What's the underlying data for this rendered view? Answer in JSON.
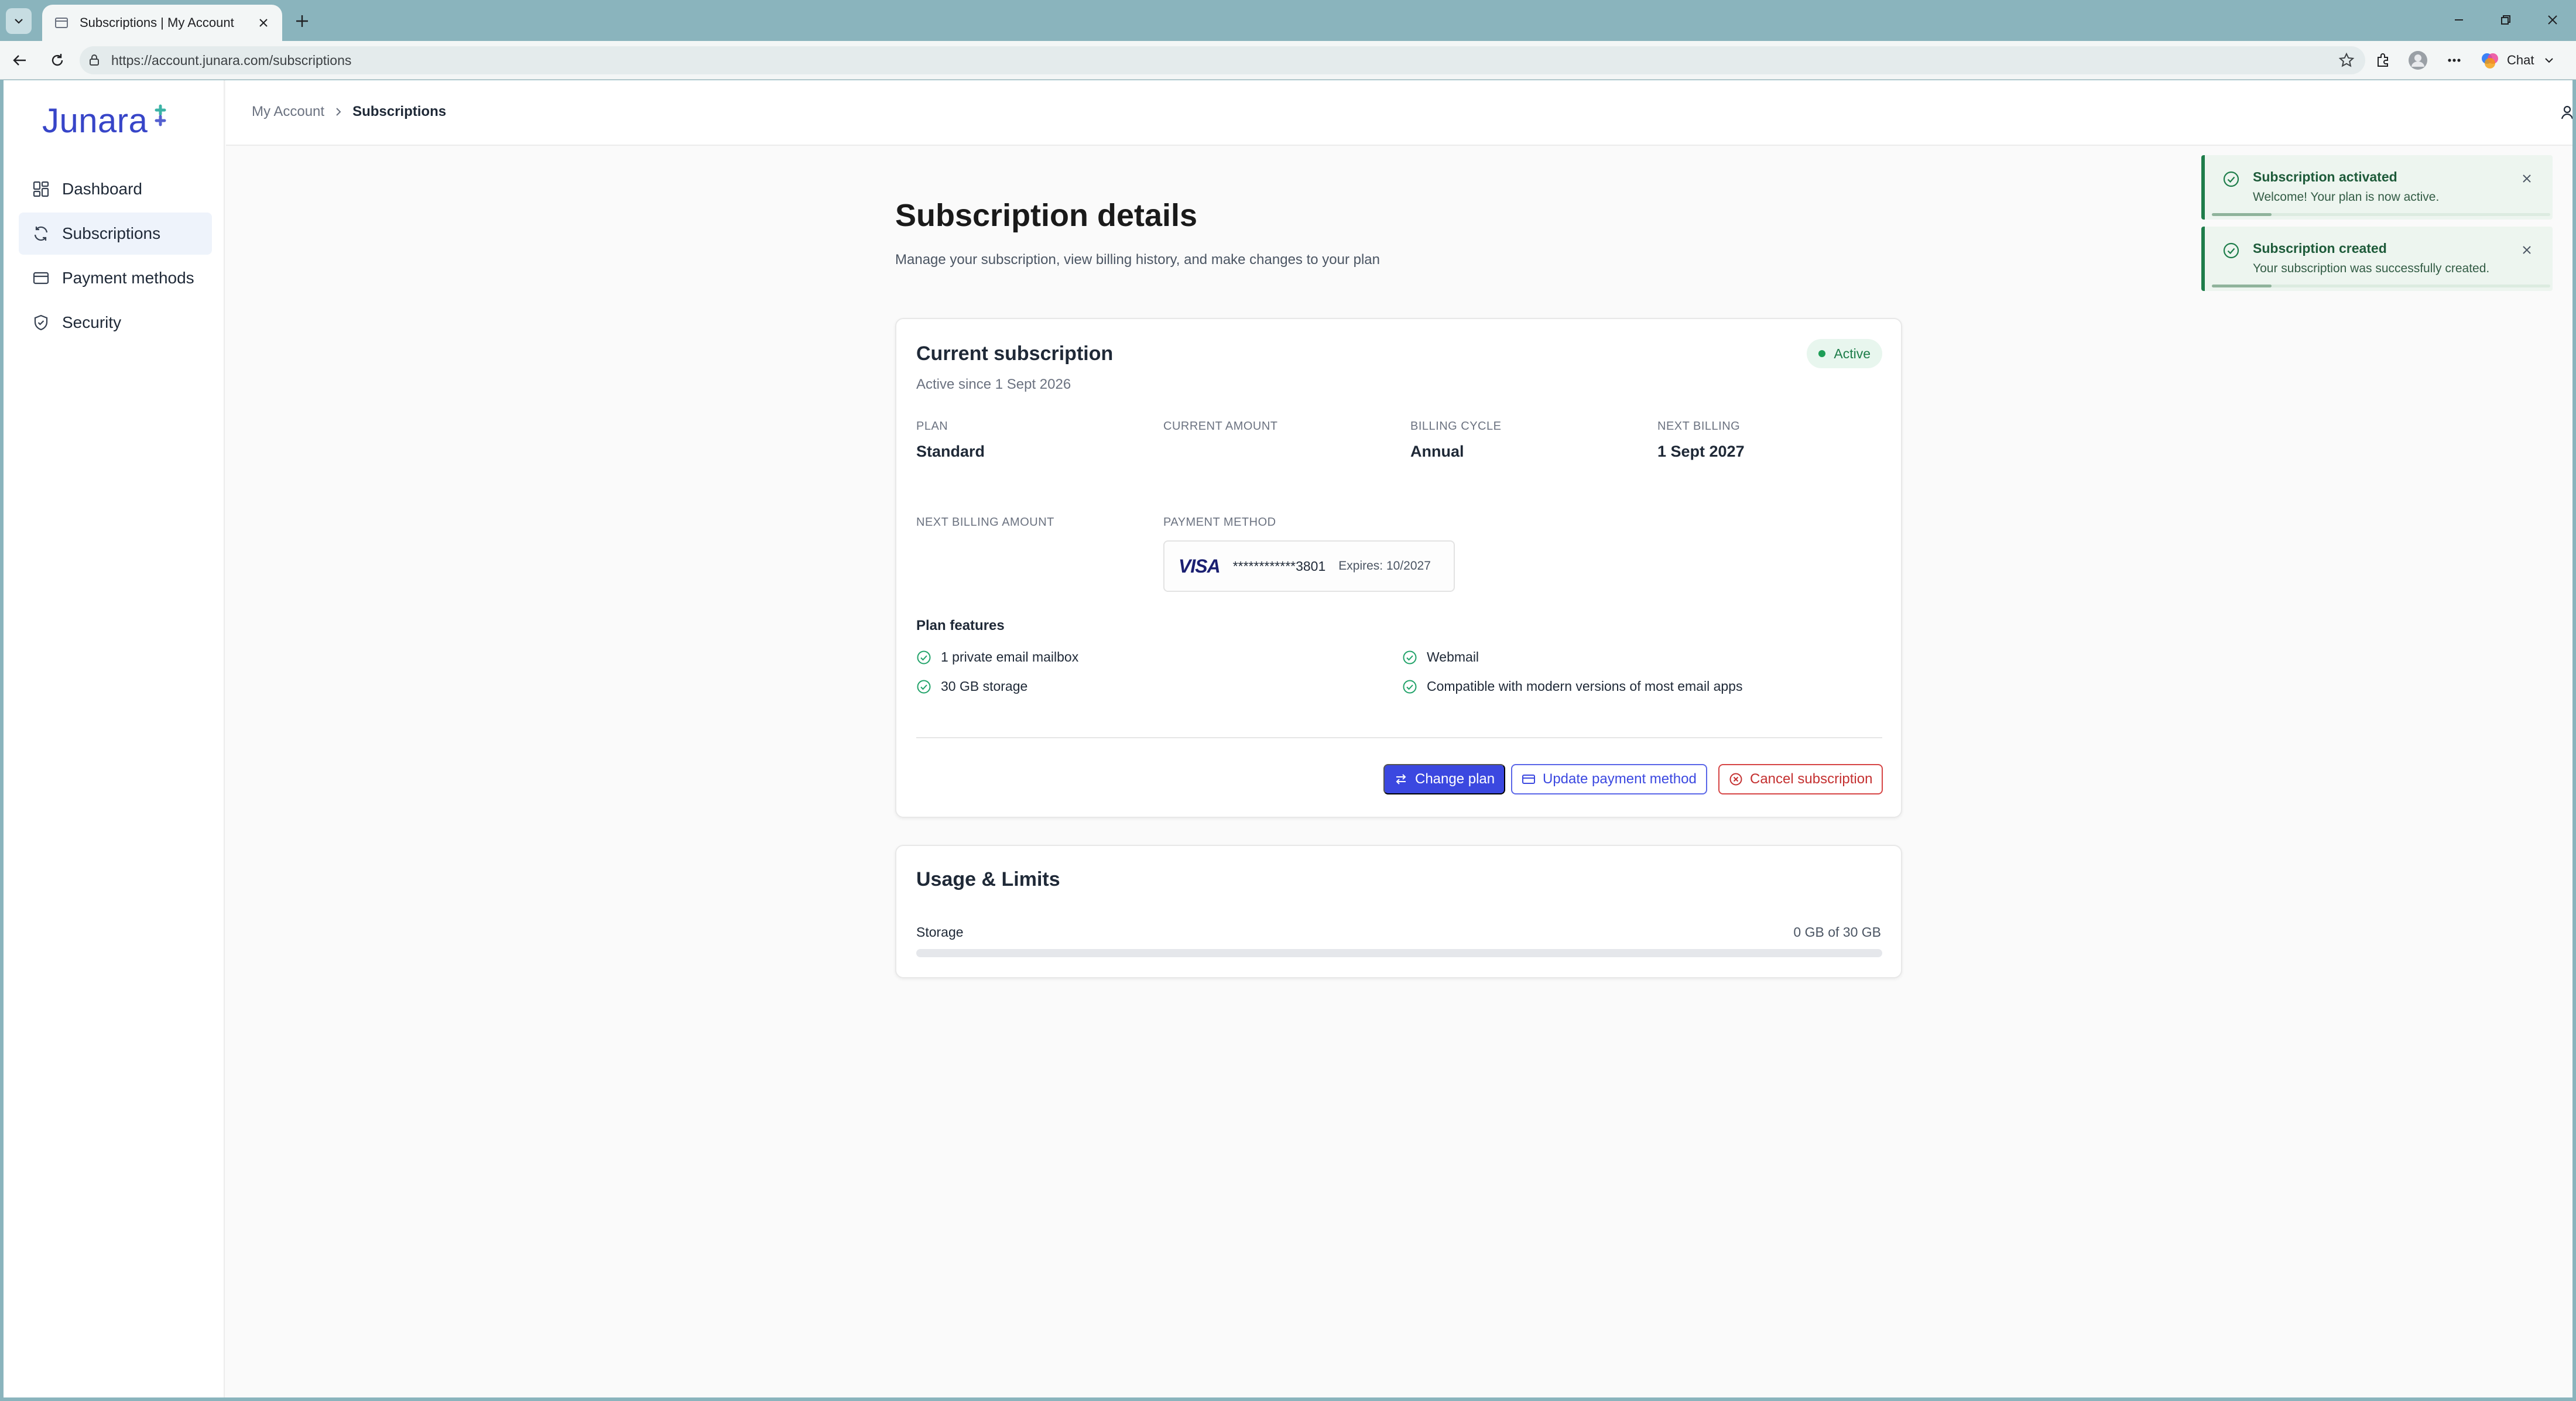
{
  "browser": {
    "tab_title": "Subscriptions | My Account",
    "url": "https://account.junara.com/subscriptions",
    "chat_label": "Chat"
  },
  "app": {
    "logo_text": "Junara",
    "brand_color": "#3745c8",
    "accent_color": "#3b48e0"
  },
  "sidebar": {
    "items": [
      {
        "label": "Dashboard",
        "icon": "dashboard-icon",
        "active": false
      },
      {
        "label": "Subscriptions",
        "icon": "refresh-icon",
        "active": true
      },
      {
        "label": "Payment methods",
        "icon": "credit-card-icon",
        "active": false
      },
      {
        "label": "Security",
        "icon": "shield-icon",
        "active": false
      }
    ]
  },
  "header": {
    "breadcrumb": [
      "My Account",
      "Subscriptions"
    ]
  },
  "page": {
    "title": "Subscription details",
    "subtitle": "Manage your subscription, view billing history, and make changes to your plan"
  },
  "subscription": {
    "card_title": "Current subscription",
    "active_since": "Active since 1 Sept 2026",
    "status": "Active",
    "status_color": "#1e7d4a",
    "fields": {
      "plan": {
        "label": "PLAN",
        "value": "Standard"
      },
      "current_amount": {
        "label": "CURRENT AMOUNT",
        "value": ""
      },
      "billing_cycle": {
        "label": "BILLING CYCLE",
        "value": "Annual"
      },
      "next_billing": {
        "label": "NEXT BILLING",
        "value": "1 Sept 2027"
      },
      "next_billing_amount": {
        "label": "NEXT BILLING AMOUNT",
        "value": ""
      },
      "payment_method": {
        "label": "PAYMENT METHOD"
      }
    },
    "payment_card": {
      "brand": "VISA",
      "number": "************3801",
      "expires": "Expires: 10/2027"
    },
    "features_title": "Plan features",
    "features": [
      "1 private email mailbox",
      "Webmail",
      "30 GB storage",
      "Compatible with modern versions of most email apps"
    ],
    "actions": {
      "change_plan": "Change plan",
      "update_payment": "Update payment method",
      "cancel": "Cancel subscription"
    }
  },
  "usage": {
    "title": "Usage & Limits",
    "storage_label": "Storage",
    "storage_value": "0 GB of 30 GB",
    "storage_used_fraction": 0
  },
  "toasts": [
    {
      "title": "Subscription activated",
      "message": "Welcome! Your plan is now active."
    },
    {
      "title": "Subscription created",
      "message": "Your subscription was successfully created."
    }
  ]
}
